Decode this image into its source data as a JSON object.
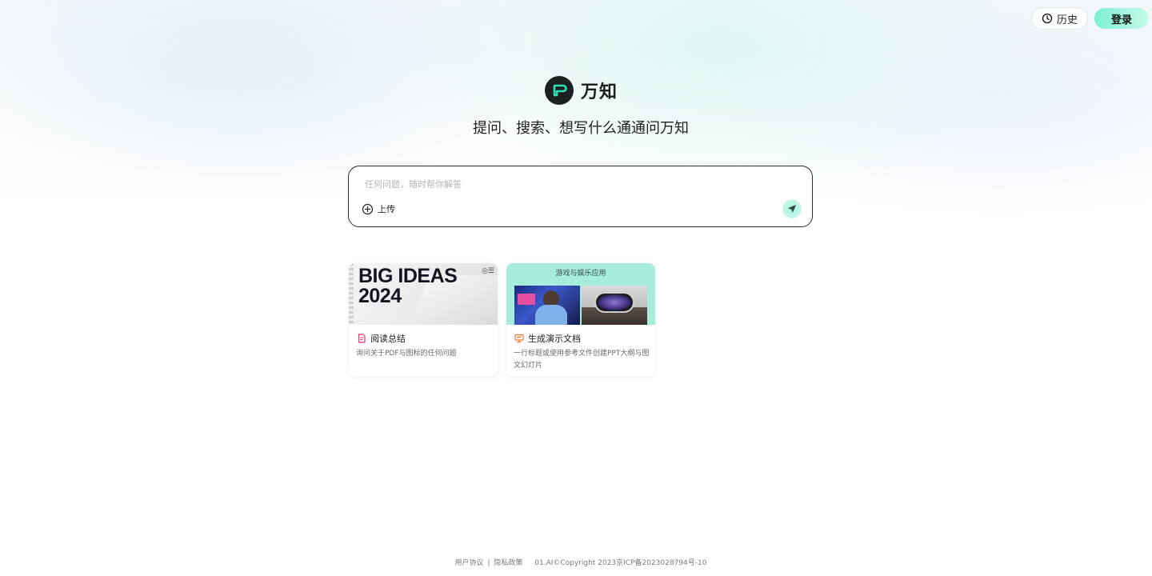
{
  "header": {
    "history_label": "历史",
    "login_label": "登录"
  },
  "brand": {
    "name": "万知",
    "tagline": "提问、搜索、想写什么通通问万知"
  },
  "search": {
    "placeholder": "任何问题，随时帮你解答",
    "value": "",
    "upload_label": "上传"
  },
  "cards": [
    {
      "thumb_text_line1": "BIG IDEAS",
      "thumb_text_line2": "2024",
      "title": "阅读总结",
      "description": "询问关于PDF与图标的任何问题",
      "icon": "document-icon",
      "icon_color": "#e8356b"
    },
    {
      "thumb_label": "游戏与娱乐应用",
      "title": "生成演示文档",
      "description": "一行标题或使用参考文件创建PPT大纲与图文幻灯片",
      "icon": "presentation-icon",
      "icon_color": "#f07a2c"
    }
  ],
  "footer": {
    "user_agreement": "用户协议",
    "separator": "|",
    "privacy_policy": "隐私政策",
    "copyright": "01.AI©Copyright 2023京ICP备2023028794号-10"
  },
  "colors": {
    "accent": "#7bf0d4",
    "logo_bg": "#1d2021",
    "logo_mark": "#2fe0b4",
    "card_thumb_bg": "#a6eedb"
  }
}
